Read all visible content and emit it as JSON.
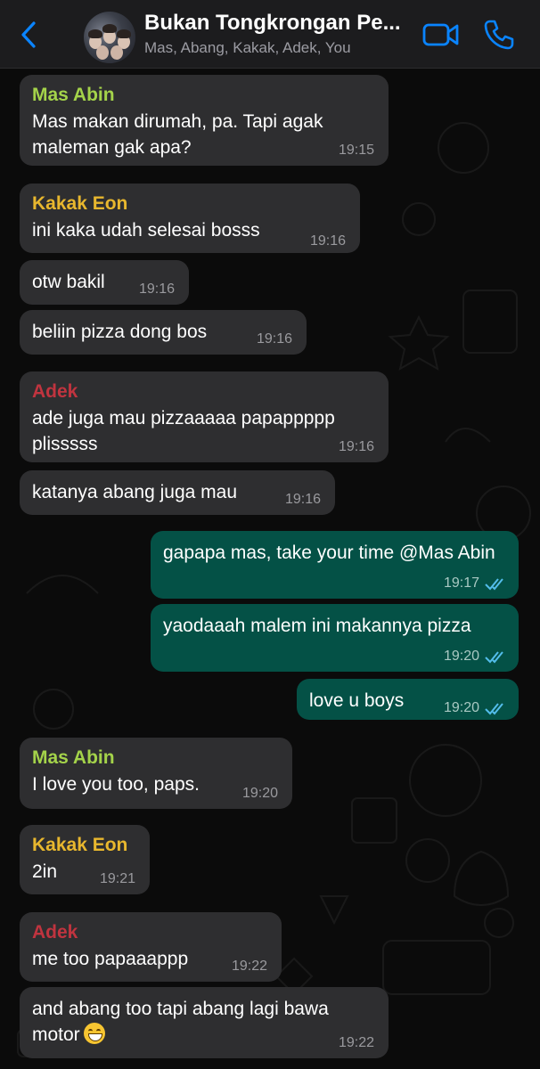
{
  "header": {
    "title": "Bukan Tongkrongan Pe...",
    "subtitle": "Mas, Abang, Kakak, Adek, You"
  },
  "colors": {
    "accent": "#0a84ff",
    "incoming_bubble": "#2e2e30",
    "outgoing_bubble": "#045146",
    "sender_mas_abin": "#a4d34a",
    "sender_kakak_eon": "#e8b72e",
    "sender_adek": "#c0343f",
    "read_ticks": "#53bdeb"
  },
  "messages": [
    {
      "sender": "Mas Abin",
      "text": "Mas makan dirumah, pa. Tapi agak maleman gak apa?",
      "time": "19:15"
    },
    {
      "sender": "Kakak Eon",
      "text": "ini kaka udah selesai bosss",
      "time": "19:16"
    },
    {
      "text": "otw bakil",
      "time": "19:16"
    },
    {
      "text": "beliin pizza dong bos",
      "time": "19:16"
    },
    {
      "sender": "Adek",
      "text": "ade juga mau pizzaaaaa papappppp plisssss",
      "time": "19:16"
    },
    {
      "text": "katanya abang juga mau",
      "time": "19:16"
    },
    {
      "text": "gapapa mas, take your time @Mas Abin",
      "time": "19:17"
    },
    {
      "text": "yaodaaah malem ini makannya pizza",
      "time": "19:20"
    },
    {
      "text": "love u boys",
      "time": "19:20"
    },
    {
      "sender": "Mas Abin",
      "text": "I love you too, paps.",
      "time": "19:20"
    },
    {
      "sender": "Kakak Eon",
      "text": "2in",
      "time": "19:21"
    },
    {
      "sender": "Adek",
      "text": "me too papaaappp",
      "time": "19:22"
    },
    {
      "text": "and abang too tapi abang lagi bawa motor",
      "time": "19:22",
      "emoji": "grinning-face"
    }
  ]
}
